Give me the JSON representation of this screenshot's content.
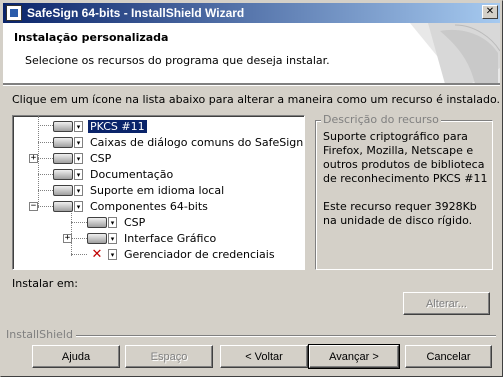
{
  "window": {
    "title": "SafeSign 64-bits - InstallShield Wizard",
    "close_glyph": "✕"
  },
  "header": {
    "title": "Instalação personalizada",
    "subtitle": "Selecione os recursos do programa que deseja instalar."
  },
  "instruction": "Clique em um ícone na lista abaixo para alterar a maneira como um recurso é instalado.",
  "tree": {
    "items": [
      {
        "label": "PKCS #11",
        "icon": "hard-disk-icon",
        "selected": true
      },
      {
        "label": "Caixas de diálogo comuns do SafeSign",
        "icon": "hard-disk-icon"
      },
      {
        "label": "CSP",
        "icon": "hard-disk-icon",
        "expander": "+"
      },
      {
        "label": "Documentação",
        "icon": "hard-disk-icon"
      },
      {
        "label": "Suporte em idioma local",
        "icon": "hard-disk-icon"
      },
      {
        "label": "Componentes 64-bits",
        "icon": "hard-disk-icon",
        "expander": "−"
      },
      {
        "label": "CSP",
        "icon": "hard-disk-icon"
      },
      {
        "label": "Interface Gráfico",
        "icon": "hard-disk-icon",
        "expander": "+"
      },
      {
        "label": "Gerenciador de credenciais",
        "icon": "not-available-icon"
      }
    ],
    "expander_plus": "+",
    "expander_minus": "−",
    "red_x": "✕",
    "dropdown_glyph": "▾"
  },
  "description": {
    "legend": "Descrição do recurso",
    "text": "Suporte criptográfico para Firefox, Mozilla, Netscape e outros produtos de biblioteca de reconhecimento PKCS #11",
    "size": "Este recurso requer 3928Kb na unidade de disco rígido."
  },
  "install_at_label": "Instalar em:",
  "buttons": {
    "change": "Alterar...",
    "help": "Ajuda",
    "space": "Espaço",
    "back": "< Voltar",
    "next": "Avançar >",
    "cancel": "Cancelar"
  },
  "brand_label": "InstallShield"
}
